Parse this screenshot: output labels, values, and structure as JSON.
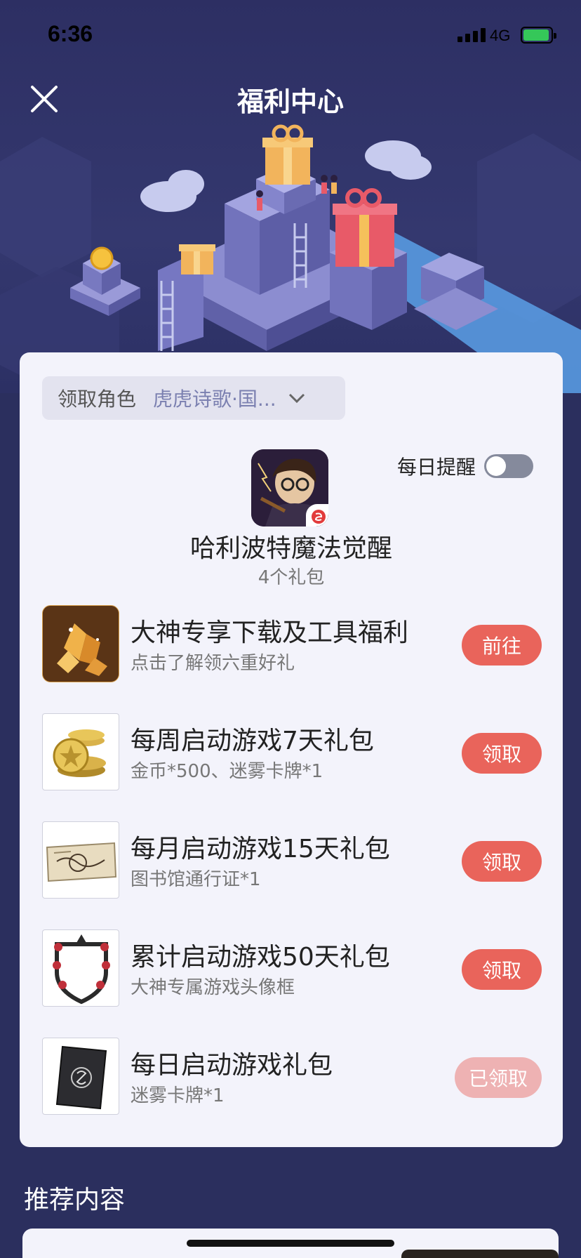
{
  "status_bar": {
    "time": "6:36",
    "network": "4G"
  },
  "header": {
    "title": "福利中心"
  },
  "role_select": {
    "label": "领取角色",
    "value": "虎虎诗歌·国..."
  },
  "reminder": {
    "label": "每日提醒",
    "enabled": false
  },
  "game": {
    "name": "哈利波特魔法觉醒",
    "gift_count": "4个礼包"
  },
  "gifts": [
    {
      "title": "大神专享下载及工具福利",
      "subtitle": "点击了解领六重好礼",
      "button": "前往",
      "thumb": "gold-gems-icon"
    },
    {
      "title": "每周启动游戏7天礼包",
      "subtitle": "金币*500、迷雾卡牌*1",
      "button": "领取",
      "thumb": "gold-coins-icon"
    },
    {
      "title": "每月启动游戏15天礼包",
      "subtitle": "图书馆通行证*1",
      "button": "领取",
      "thumb": "library-pass-icon"
    },
    {
      "title": "累计启动游戏50天礼包",
      "subtitle": "大神专属游戏头像框",
      "button": "领取",
      "thumb": "avatar-frame-icon"
    },
    {
      "title": "每日启动游戏礼包",
      "subtitle": "迷雾卡牌*1",
      "button": "已领取",
      "thumb": "mist-card-icon"
    }
  ],
  "recommend": {
    "title": "推荐内容"
  },
  "colors": {
    "accent": "#e9645b",
    "accent_disabled": "#eeb2b3",
    "background": "#2b2f5e"
  }
}
